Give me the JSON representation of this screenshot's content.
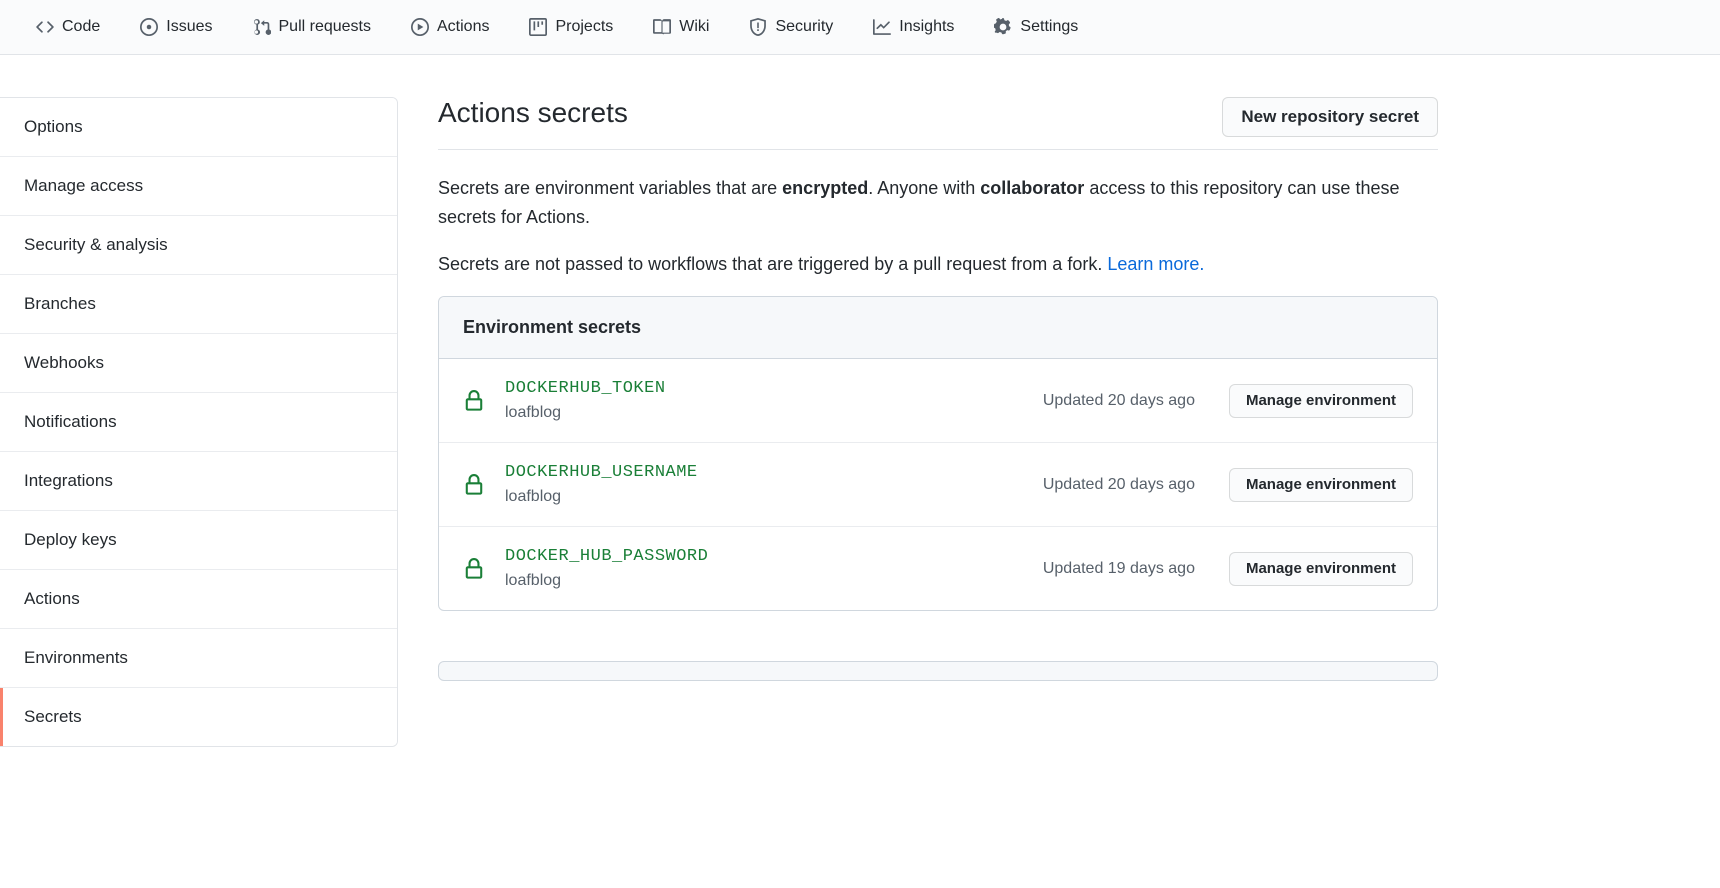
{
  "repo_nav": [
    {
      "key": "code",
      "label": "Code"
    },
    {
      "key": "issues",
      "label": "Issues"
    },
    {
      "key": "pulls",
      "label": "Pull requests"
    },
    {
      "key": "actions",
      "label": "Actions"
    },
    {
      "key": "projects",
      "label": "Projects"
    },
    {
      "key": "wiki",
      "label": "Wiki"
    },
    {
      "key": "security",
      "label": "Security"
    },
    {
      "key": "insights",
      "label": "Insights"
    },
    {
      "key": "settings",
      "label": "Settings"
    }
  ],
  "sidebar": {
    "items": [
      {
        "label": "Options"
      },
      {
        "label": "Manage access"
      },
      {
        "label": "Security & analysis"
      },
      {
        "label": "Branches"
      },
      {
        "label": "Webhooks"
      },
      {
        "label": "Notifications"
      },
      {
        "label": "Integrations"
      },
      {
        "label": "Deploy keys"
      },
      {
        "label": "Actions"
      },
      {
        "label": "Environments"
      },
      {
        "label": "Secrets",
        "active": true
      }
    ]
  },
  "header": {
    "title": "Actions secrets",
    "new_button": "New repository secret"
  },
  "intro": {
    "p1_a": "Secrets are environment variables that are ",
    "p1_b": "encrypted",
    "p1_c": ". Anyone with ",
    "p1_d": "collaborator",
    "p1_e": " access to this repository can use these secrets for Actions.",
    "p2_a": "Secrets are not passed to workflows that are triggered by a pull request from a fork. ",
    "p2_link": "Learn more.",
    "learn_more_href": "#"
  },
  "env_box": {
    "title": "Environment secrets",
    "manage_label": "Manage environment",
    "secrets": [
      {
        "name": "DOCKERHUB_TOKEN",
        "env": "loafblog",
        "updated": "Updated 20 days ago"
      },
      {
        "name": "DOCKERHUB_USERNAME",
        "env": "loafblog",
        "updated": "Updated 20 days ago"
      },
      {
        "name": "DOCKER_HUB_PASSWORD",
        "env": "loafblog",
        "updated": "Updated 19 days ago"
      }
    ]
  }
}
